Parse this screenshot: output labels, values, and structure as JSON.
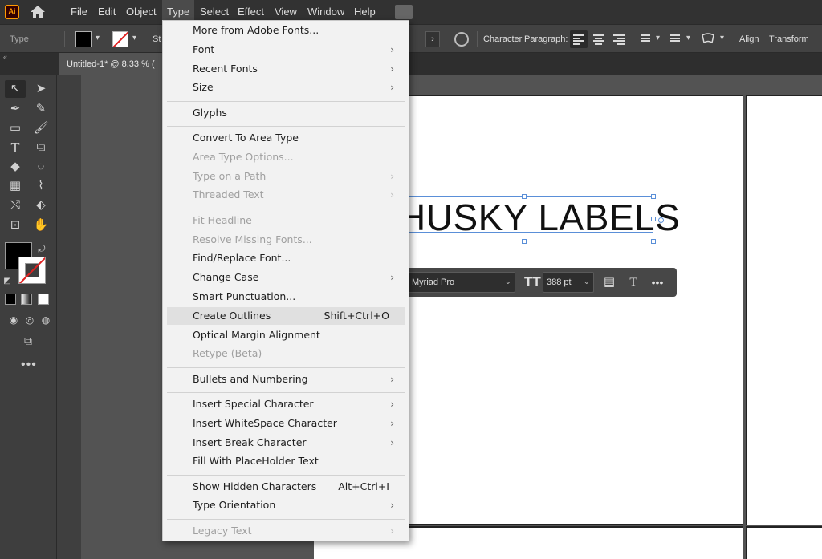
{
  "app": {
    "logo": "Ai"
  },
  "menubar": {
    "items": [
      "File",
      "Edit",
      "Object",
      "Type",
      "Select",
      "Effect",
      "View",
      "Window",
      "Help"
    ],
    "active": "Type"
  },
  "control_bar": {
    "mode_label": "Type",
    "stroke_label": "St",
    "character_link": "Character",
    "paragraph_link": "Paragraph:",
    "align_link": "Align",
    "transform_link": "Transform"
  },
  "document_tab": {
    "title": "Untitled-1* @ 8.33 % ("
  },
  "canvas": {
    "text": "HUSKY LABELS"
  },
  "context_bar": {
    "font": "Myriad Pro",
    "size": "388 pt",
    "more_glyph": "•••"
  },
  "tools": {
    "more_glyph": "•••"
  },
  "type_menu": {
    "groups": [
      [
        {
          "label": "More from Adobe Fonts...",
          "enabled": true,
          "submenu": false
        },
        {
          "label": "Font",
          "enabled": true,
          "submenu": true
        },
        {
          "label": "Recent Fonts",
          "enabled": true,
          "submenu": true
        },
        {
          "label": "Size",
          "enabled": true,
          "submenu": true
        }
      ],
      [
        {
          "label": "Glyphs",
          "enabled": true,
          "submenu": false
        }
      ],
      [
        {
          "label": "Convert To Area Type",
          "enabled": true,
          "submenu": false
        },
        {
          "label": "Area Type Options...",
          "enabled": false,
          "submenu": false
        },
        {
          "label": "Type on a Path",
          "enabled": false,
          "submenu": true
        },
        {
          "label": "Threaded Text",
          "enabled": false,
          "submenu": true
        }
      ],
      [
        {
          "label": "Fit Headline",
          "enabled": false,
          "submenu": false
        },
        {
          "label": "Resolve Missing Fonts...",
          "enabled": false,
          "submenu": false
        },
        {
          "label": "Find/Replace Font...",
          "enabled": true,
          "submenu": false
        },
        {
          "label": "Change Case",
          "enabled": true,
          "submenu": true
        },
        {
          "label": "Smart Punctuation...",
          "enabled": true,
          "submenu": false
        },
        {
          "label": "Create Outlines",
          "enabled": true,
          "submenu": false,
          "shortcut": "Shift+Ctrl+O",
          "highlighted": true
        },
        {
          "label": "Optical Margin Alignment",
          "enabled": true,
          "submenu": false
        },
        {
          "label": "Retype (Beta)",
          "enabled": false,
          "submenu": false
        }
      ],
      [
        {
          "label": "Bullets and Numbering",
          "enabled": true,
          "submenu": true
        }
      ],
      [
        {
          "label": "Insert Special Character",
          "enabled": true,
          "submenu": true
        },
        {
          "label": "Insert WhiteSpace Character",
          "enabled": true,
          "submenu": true
        },
        {
          "label": "Insert Break Character",
          "enabled": true,
          "submenu": true
        },
        {
          "label": "Fill With PlaceHolder Text",
          "enabled": true,
          "submenu": false
        }
      ],
      [
        {
          "label": "Show Hidden Characters",
          "enabled": true,
          "submenu": false,
          "shortcut": "Alt+Ctrl+I"
        },
        {
          "label": "Type Orientation",
          "enabled": true,
          "submenu": true
        }
      ],
      [
        {
          "label": "Legacy Text",
          "enabled": false,
          "submenu": true
        }
      ]
    ]
  }
}
